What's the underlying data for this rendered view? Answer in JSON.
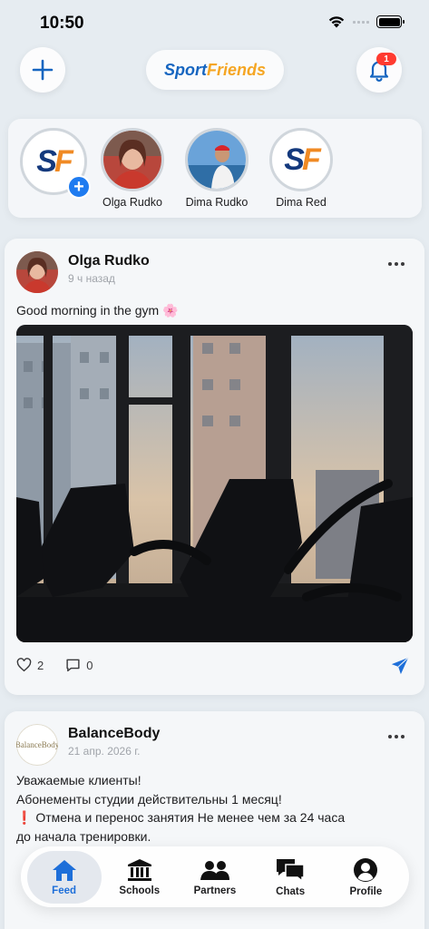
{
  "status_bar": {
    "time": "10:50"
  },
  "header": {
    "logo_part1": "Sport",
    "logo_part2": "Friends",
    "notification_count": "1"
  },
  "stories": [
    {
      "name": "",
      "type": "add-story"
    },
    {
      "name": "Olga Rudko"
    },
    {
      "name": "Dima Rudko"
    },
    {
      "name": "Dima Red"
    }
  ],
  "posts": [
    {
      "author": "Olga Rudko",
      "time": "9 ч назад",
      "text": "Good morning in the gym 🌸",
      "likes": "2",
      "comments": "0"
    },
    {
      "author": "BalanceBody",
      "time": "21 апр. 2026 г.",
      "avatar_text": "BalanceBody",
      "lines": [
        "Уважаемые клиенты!",
        "Абонементы студии действительны 1 месяц!",
        "❗ Отмена и перенос занятия Не менее чем за 24 часа",
        "до начала тренировки."
      ]
    }
  ],
  "tab_bar": {
    "tabs": [
      {
        "label": "Feed",
        "icon": "home-icon",
        "active": true
      },
      {
        "label": "Schools",
        "icon": "school-icon"
      },
      {
        "label": "Partners",
        "icon": "partners-icon"
      },
      {
        "label": "Chats",
        "icon": "chats-icon"
      },
      {
        "label": "Profile",
        "icon": "profile-icon"
      }
    ]
  },
  "colors": {
    "accent": "#1e6fd9",
    "badge": "#ff3b30",
    "logo_blue": "#1565c0",
    "logo_orange": "#f5a623"
  }
}
